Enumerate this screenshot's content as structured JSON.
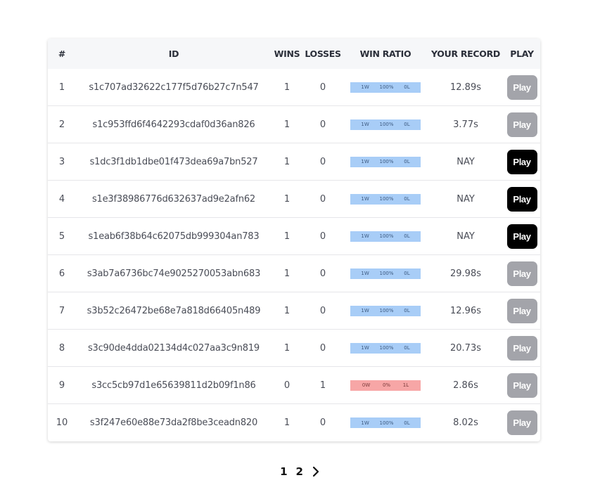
{
  "table": {
    "headers": {
      "num": "#",
      "id": "ID",
      "wins": "WINS",
      "losses": "LOSSES",
      "win_ratio": "WIN RATIO",
      "your_record": "YOUR RECORD",
      "play": "PLAY"
    },
    "rows": [
      {
        "num": "1",
        "id": "s1c707ad32622c177f5d76b27c7n547",
        "wins": "1",
        "losses": "0",
        "ratio_w": "1W",
        "ratio_pct": "100%",
        "ratio_l": "0L",
        "win_fraction": 1.0,
        "record": "12.89s",
        "play_label": "Play",
        "played": true
      },
      {
        "num": "2",
        "id": "s1c953ffd6f4642293cdaf0d36an826",
        "wins": "1",
        "losses": "0",
        "ratio_w": "1W",
        "ratio_pct": "100%",
        "ratio_l": "0L",
        "win_fraction": 1.0,
        "record": "3.77s",
        "play_label": "Play",
        "played": true
      },
      {
        "num": "3",
        "id": "s1dc3f1db1dbe01f473dea69a7bn527",
        "wins": "1",
        "losses": "0",
        "ratio_w": "1W",
        "ratio_pct": "100%",
        "ratio_l": "0L",
        "win_fraction": 1.0,
        "record": "NAY",
        "play_label": "Play",
        "played": false
      },
      {
        "num": "4",
        "id": "s1e3f38986776d632637ad9e2afn62",
        "wins": "1",
        "losses": "0",
        "ratio_w": "1W",
        "ratio_pct": "100%",
        "ratio_l": "0L",
        "win_fraction": 1.0,
        "record": "NAY",
        "play_label": "Play",
        "played": false
      },
      {
        "num": "5",
        "id": "s1eab6f38b64c62075db999304an783",
        "wins": "1",
        "losses": "0",
        "ratio_w": "1W",
        "ratio_pct": "100%",
        "ratio_l": "0L",
        "win_fraction": 1.0,
        "record": "NAY",
        "play_label": "Play",
        "played": false
      },
      {
        "num": "6",
        "id": "s3ab7a6736bc74e9025270053abn683",
        "wins": "1",
        "losses": "0",
        "ratio_w": "1W",
        "ratio_pct": "100%",
        "ratio_l": "0L",
        "win_fraction": 1.0,
        "record": "29.98s",
        "play_label": "Play",
        "played": true
      },
      {
        "num": "7",
        "id": "s3b52c26472be68e7a818d66405n489",
        "wins": "1",
        "losses": "0",
        "ratio_w": "1W",
        "ratio_pct": "100%",
        "ratio_l": "0L",
        "win_fraction": 1.0,
        "record": "12.96s",
        "play_label": "Play",
        "played": true
      },
      {
        "num": "8",
        "id": "s3c90de4dda02134d4c027aa3c9n819",
        "wins": "1",
        "losses": "0",
        "ratio_w": "1W",
        "ratio_pct": "100%",
        "ratio_l": "0L",
        "win_fraction": 1.0,
        "record": "20.73s",
        "play_label": "Play",
        "played": true
      },
      {
        "num": "9",
        "id": "s3cc5cb97d1e65639811d2b09f1n86",
        "wins": "0",
        "losses": "1",
        "ratio_w": "0W",
        "ratio_pct": "0%",
        "ratio_l": "1L",
        "win_fraction": 0.0,
        "record": "2.86s",
        "play_label": "Play",
        "played": true
      },
      {
        "num": "10",
        "id": "s3f247e60e88e73da2f8be3ceadn820",
        "wins": "1",
        "losses": "0",
        "ratio_w": "1W",
        "ratio_pct": "100%",
        "ratio_l": "0L",
        "win_fraction": 1.0,
        "record": "8.02s",
        "play_label": "Play",
        "played": true
      }
    ]
  },
  "pagination": {
    "pages": [
      "1",
      "2"
    ],
    "next_icon": "chevron-right-icon"
  },
  "colors": {
    "win_bar": "#a8cdf7",
    "loss_bar": "#f7a6a6",
    "play_played": "#a3a4aa",
    "play_unplayed": "#000000"
  }
}
